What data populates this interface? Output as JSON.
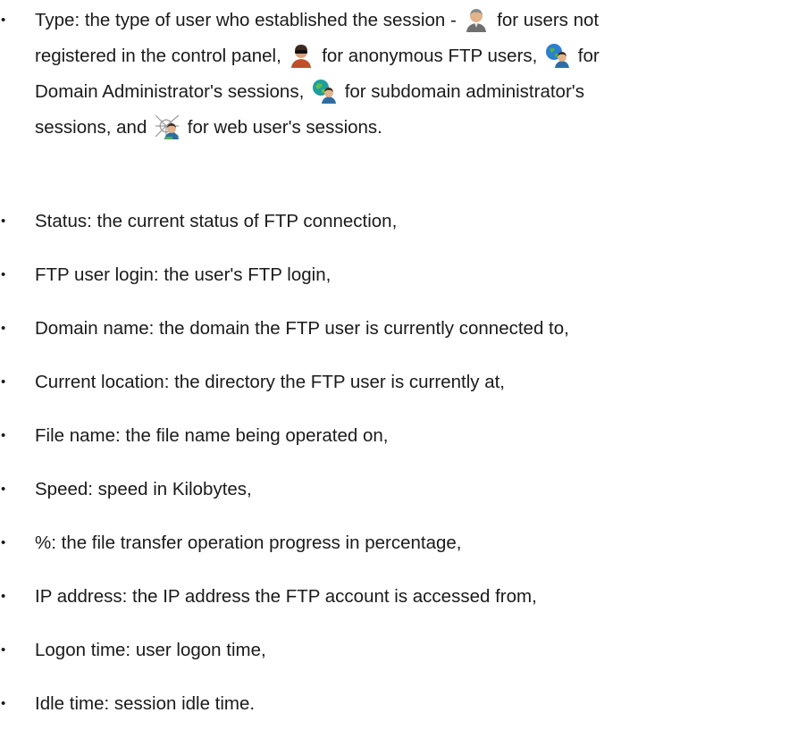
{
  "type_item": {
    "seg1": "Type: the type of user who established the session -",
    "seg2": "for users not",
    "seg3": "registered in the control panel,",
    "seg4": "for anonymous FTP users,",
    "seg5": "for",
    "seg6": "Domain Administrator's sessions,",
    "seg7": "for subdomain administrator's",
    "seg8": "sessions, and",
    "seg9": "for web user's sessions.",
    "icons": [
      "unregistered-user-icon",
      "anonymous-ftp-user-icon",
      "domain-administrator-icon",
      "subdomain-administrator-icon",
      "web-user-icon"
    ]
  },
  "items": [
    "Status: the current status of FTP connection,",
    "FTP user login: the user's FTP login,",
    "Domain name: the domain the FTP user is currently connected to,",
    "Current location: the directory the FTP user is currently at,",
    "File name: the file name being operated on,",
    "Speed: speed in Kilobytes,",
    "%: the file transfer operation progress in percentage,",
    "IP address: the IP address the FTP account is accessed from,",
    "Logon time: user logon time,",
    "Idle time: session idle time."
  ],
  "bullet_char": "•"
}
